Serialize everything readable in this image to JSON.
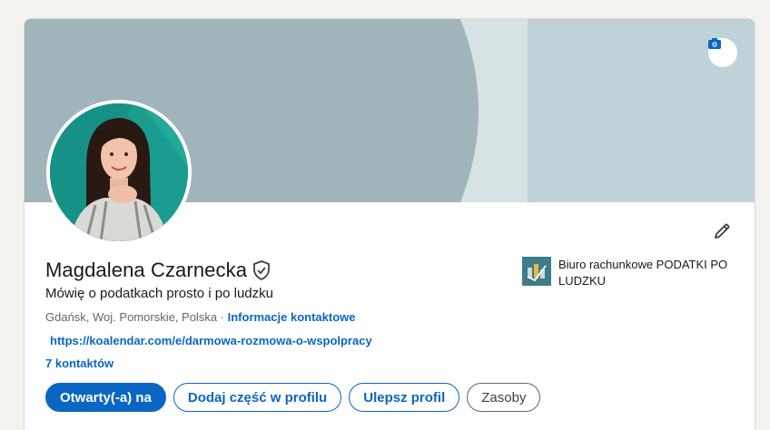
{
  "profile": {
    "name": "Magdalena Czarnecka",
    "headline": "Mówię o podatkach prosto i po ludzku",
    "location": "Gdańsk, Woj. Pomorskie, Polska",
    "separator": " · ",
    "contact_info_label": "Informacje kontaktowe",
    "website": "https://koalendar.com/e/darmowa-rozmowa-o-wspolpracy",
    "connections": "7 kontaktów"
  },
  "company": {
    "name": "Biuro rachunkowe PODATKI PO LUDZKU"
  },
  "actions": {
    "open_to": "Otwarty(-a) na",
    "add_section": "Dodaj część w profilu",
    "enhance_profile": "Ulepsz profil",
    "resources": "Zasoby"
  },
  "icons": {
    "cover_camera": "camera-icon",
    "edit": "pencil-icon",
    "verified": "shield-check-icon"
  },
  "colors": {
    "accent": "#0a66c2",
    "cover_left": "#a0b5b9",
    "cover_mid": "#d7e2e4",
    "cover_right": "#bfd2d7",
    "avatar_bg": "#1a9c8f"
  }
}
